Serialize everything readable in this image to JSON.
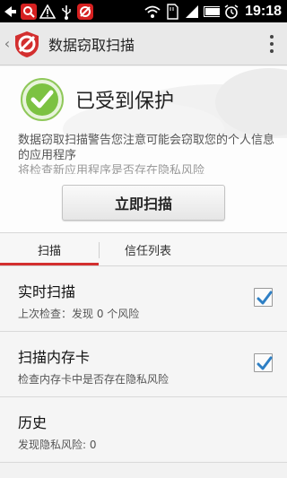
{
  "status_bar": {
    "time": "19:18",
    "icons": [
      "notification-back-icon",
      "search-app-icon",
      "warning-icon",
      "usb-icon",
      "security-app-icon",
      "wifi-icon",
      "sd-card-icon",
      "signal-icon",
      "battery-icon",
      "alarm-icon"
    ]
  },
  "app_bar": {
    "title": "数据窃取扫描",
    "icon": "security-shield-logo",
    "back_icon": "back-chevron-icon",
    "menu_icon": "overflow-menu-icon"
  },
  "hero": {
    "status": "已受到保护",
    "description": "数据窃取扫描警告您注意可能会窃取您的个人信息的应用程序",
    "description_cut_line": "将检查新应用程序是否存在隐私风险",
    "scan_button": "立即扫描",
    "accent": "#7cc242"
  },
  "tabs": [
    {
      "label": "扫描",
      "selected": true
    },
    {
      "label": "信任列表",
      "selected": false
    }
  ],
  "tab_accent": "#d32f2f",
  "settings": [
    {
      "title": "实时扫描",
      "subtitle": "上次检查：发现 0 个风险",
      "checked": true
    },
    {
      "title": "扫描内存卡",
      "subtitle": "检查内存卡中是否存在隐私风险",
      "checked": true
    },
    {
      "title": "历史",
      "subtitle": "发现隐私风险: 0",
      "checked": null
    }
  ]
}
